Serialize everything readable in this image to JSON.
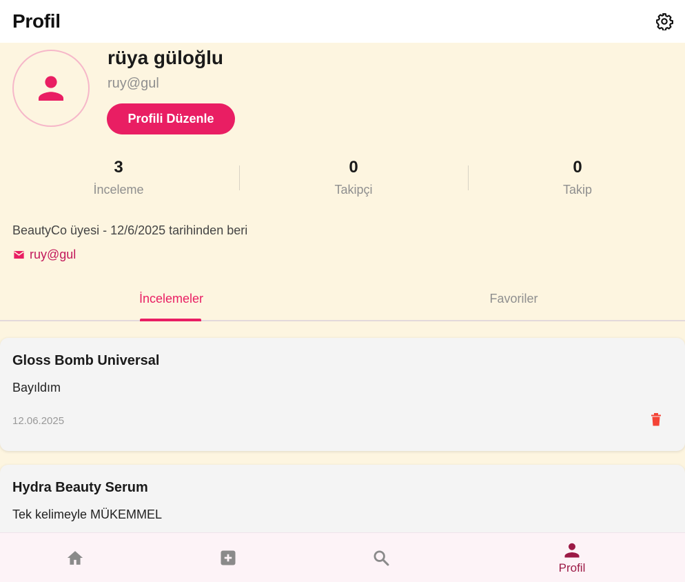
{
  "appbar": {
    "title": "Profil",
    "settings_icon": "gear-icon"
  },
  "profile": {
    "name": "rüya güloğlu",
    "username": "ruy@gul",
    "edit_label": "Profili Düzenle",
    "avatar_icon": "person-icon"
  },
  "stats": [
    {
      "value": "3",
      "label": "İnceleme"
    },
    {
      "value": "0",
      "label": "Takipçi"
    },
    {
      "value": "0",
      "label": "Takip"
    }
  ],
  "member_since": "BeautyCo üyesi - 12/6/2025 tarihinden beri",
  "contact": {
    "icon": "mail-icon",
    "email": "ruy@gul"
  },
  "tabs": [
    {
      "label": "İncelemeler",
      "active": true
    },
    {
      "label": "Favoriler",
      "active": false
    }
  ],
  "reviews": [
    {
      "title": "Gloss Bomb Universal",
      "text": "Bayıldım",
      "date": "12.06.2025"
    },
    {
      "title": "Hydra Beauty Serum",
      "text": "Tek kelimeyle MÜKEMMEL"
    }
  ],
  "nav": [
    {
      "icon": "home-icon",
      "label": ""
    },
    {
      "icon": "add-box-icon",
      "label": ""
    },
    {
      "icon": "search-icon",
      "label": ""
    },
    {
      "icon": "person-icon",
      "label": "Profil",
      "active": true
    }
  ],
  "colors": {
    "accent": "#e91e63",
    "background": "#fdf5e0",
    "nav_active": "#9c1a46",
    "delete": "#f44336"
  }
}
